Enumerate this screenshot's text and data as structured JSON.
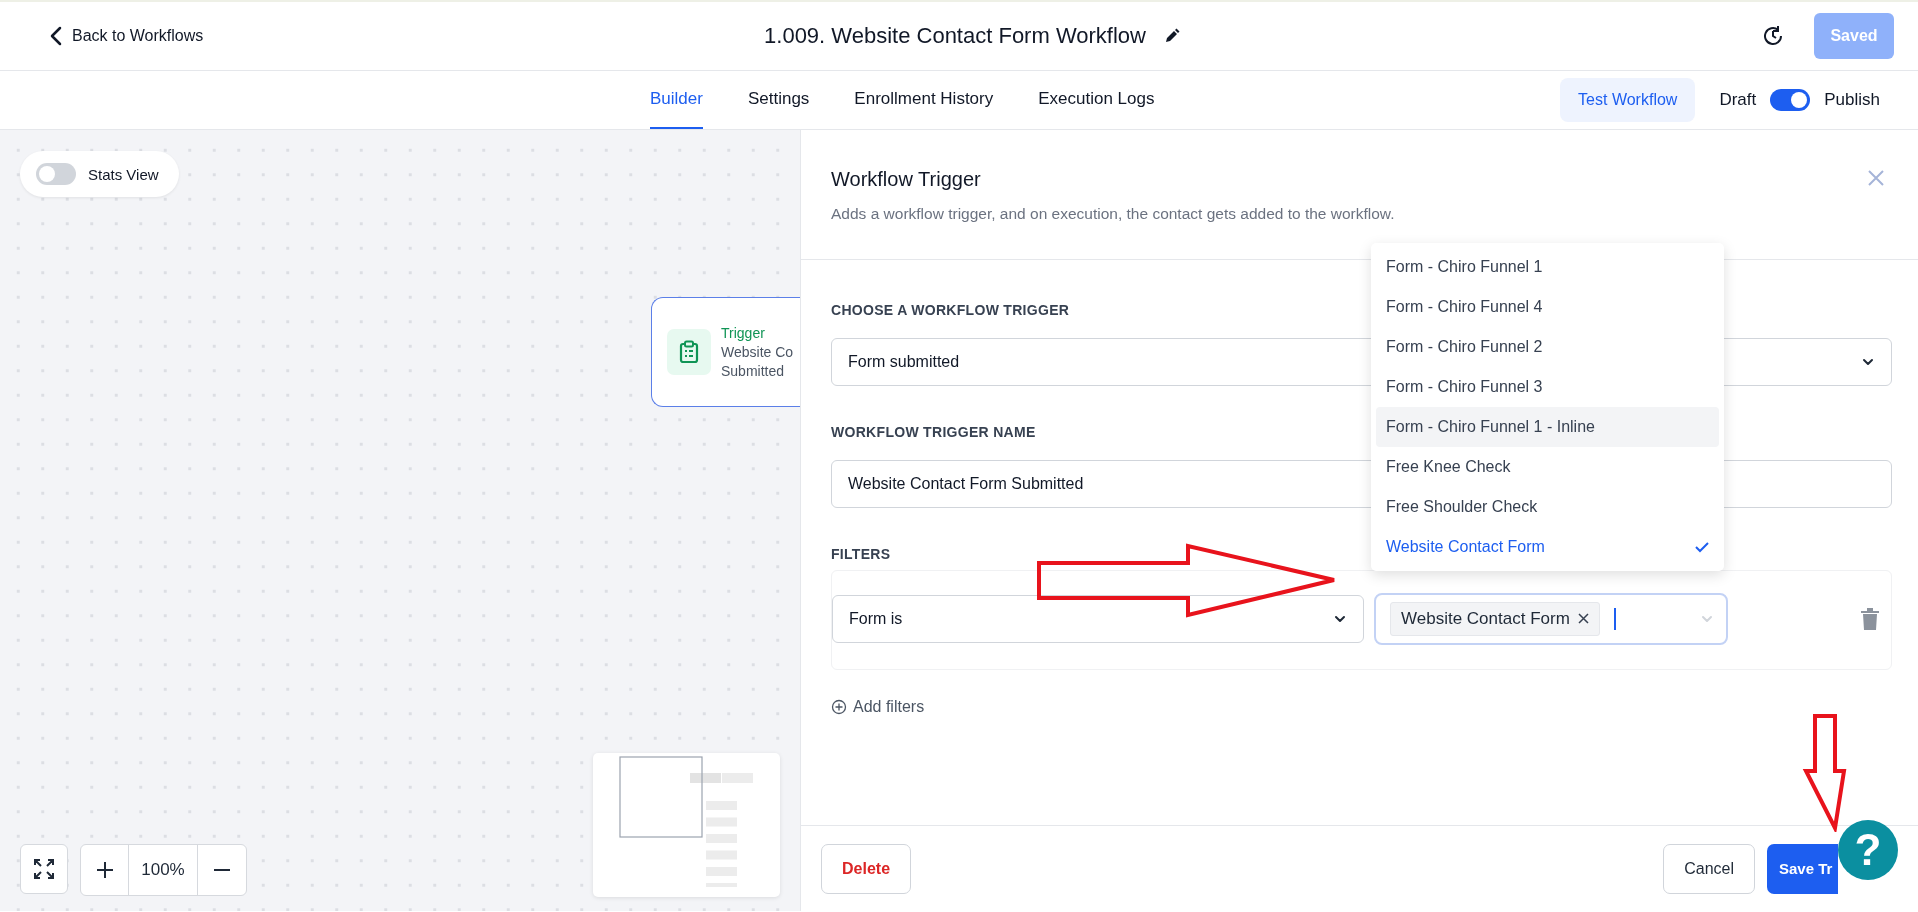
{
  "header": {
    "back_label": "Back to Workflows",
    "title": "1.009. Website Contact Form Workflow",
    "save_button": {
      "label": "Saved",
      "disabled": true
    }
  },
  "tabs": [
    {
      "label": "Builder",
      "selected": true
    },
    {
      "label": "Settings",
      "selected": false
    },
    {
      "label": "Enrollment History",
      "selected": false
    },
    {
      "label": "Execution Logs",
      "selected": false
    }
  ],
  "test_button": "Test Workflow",
  "publish_toggle": {
    "off_label": "Draft",
    "on_label": "Publish",
    "on": true
  },
  "canvas": {
    "stats_toggle": {
      "label": "Stats View",
      "on": false
    },
    "node": {
      "title": "Trigger",
      "lines": [
        "Website Co",
        "Submitted"
      ]
    },
    "zoom_level": "100%"
  },
  "panel": {
    "title": "Workflow Trigger",
    "subtitle": "Adds a workflow trigger, and on execution, the contact gets added to the workflow.",
    "fields": [
      {
        "kind": "select",
        "label": "CHOOSE A WORKFLOW TRIGGER",
        "value": "Form submitted"
      },
      {
        "kind": "input",
        "label": "WORKFLOW TRIGGER NAME",
        "value": "Website Contact Form Submitted"
      }
    ],
    "filters_label": "FILTERS",
    "filter": {
      "field": "Form is",
      "tags": [
        "Website Contact Form"
      ]
    },
    "add_filters": "Add filters",
    "dropdown": [
      {
        "label": "Form - Chiro Funnel 1",
        "highlighted": false,
        "selected": false
      },
      {
        "label": "Form - Chiro Funnel 4",
        "highlighted": false,
        "selected": false
      },
      {
        "label": "Form - Chiro Funnel 2",
        "highlighted": false,
        "selected": false
      },
      {
        "label": "Form - Chiro Funnel 3",
        "highlighted": false,
        "selected": false
      },
      {
        "label": "Form - Chiro Funnel 1 - Inline",
        "highlighted": true,
        "selected": false
      },
      {
        "label": "Free Knee Check",
        "highlighted": false,
        "selected": false
      },
      {
        "label": "Free Shoulder Check",
        "highlighted": false,
        "selected": false
      },
      {
        "label": "Website Contact Form",
        "highlighted": false,
        "selected": true
      }
    ],
    "delete_button": "Delete",
    "cancel_button": "Cancel",
    "save_button": "Save Tr"
  },
  "help_button": "?"
}
